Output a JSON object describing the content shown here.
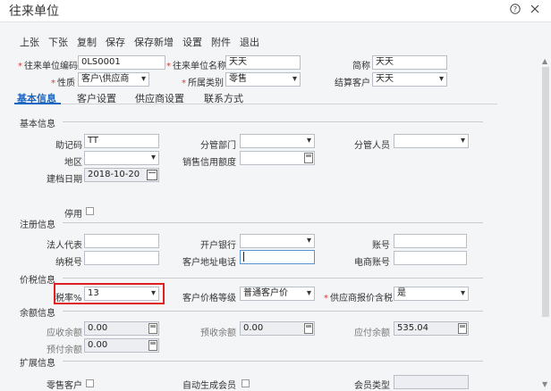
{
  "window": {
    "title": "往来单位",
    "help_icon": "help-circle-icon",
    "close_icon": "close-icon"
  },
  "toolbar": [
    "上张",
    "下张",
    "复制",
    "保存",
    "保存新增",
    "设置",
    "附件",
    "退出"
  ],
  "header_fields": {
    "code_label": "往来单位编码",
    "code_value": "0LS0001",
    "name_label": "往来单位名称",
    "name_value": "天天",
    "short_label": "简称",
    "short_value": "天天",
    "nature_label": "性质",
    "nature_value": "客户\\供应商",
    "category_label": "所属类别",
    "category_value": "零售",
    "settle_label": "结算客户",
    "settle_value": "天天"
  },
  "tabs": [
    "基本信息",
    "客户设置",
    "供应商设置",
    "联系方式"
  ],
  "basic": {
    "section": "基本信息",
    "mnemonic_label": "助记码",
    "mnemonic_value": "TT",
    "dept_label": "分管部门",
    "dept_value": "",
    "staff_label": "分管人员",
    "staff_value": "",
    "region_label": "地区",
    "region_value": "",
    "credit_label": "销售信用额度",
    "credit_value": "",
    "date_label": "建档日期",
    "date_value": "2018-10-20",
    "disabled_label": "停用"
  },
  "register": {
    "section": "注册信息",
    "legal_label": "法人代表",
    "legal_value": "",
    "bank_label": "开户银行",
    "bank_value": "",
    "account_label": "账号",
    "account_value": "",
    "tax_label": "纳税号",
    "tax_value": "",
    "addr_label": "客户地址电话",
    "addr_value": "",
    "ebank_label": "电商账号",
    "ebank_value": ""
  },
  "tax": {
    "section": "价税信息",
    "rate_label": "税率%",
    "rate_value": "13",
    "price_label": "客户价格等级",
    "price_value": "普通客户价",
    "include_label": "供应商报价含税",
    "include_value": "是"
  },
  "balance": {
    "section": "余额信息",
    "receivable_label": "应收余额",
    "receivable_value": "0.00",
    "prepaid_recv_label": "预收余额",
    "prepaid_recv_value": "0.00",
    "payable_label": "应付余额",
    "payable_value": "535.04",
    "prepay_label": "预付余额",
    "prepay_value": "0.00"
  },
  "extend": {
    "section": "扩展信息",
    "vip_label": "零售客户",
    "auto_label": "自动生成会员",
    "member_label": "会员类型"
  },
  "colors": {
    "accent": "#1a66c2",
    "highlight": "#e02020",
    "required": "#d04040"
  }
}
